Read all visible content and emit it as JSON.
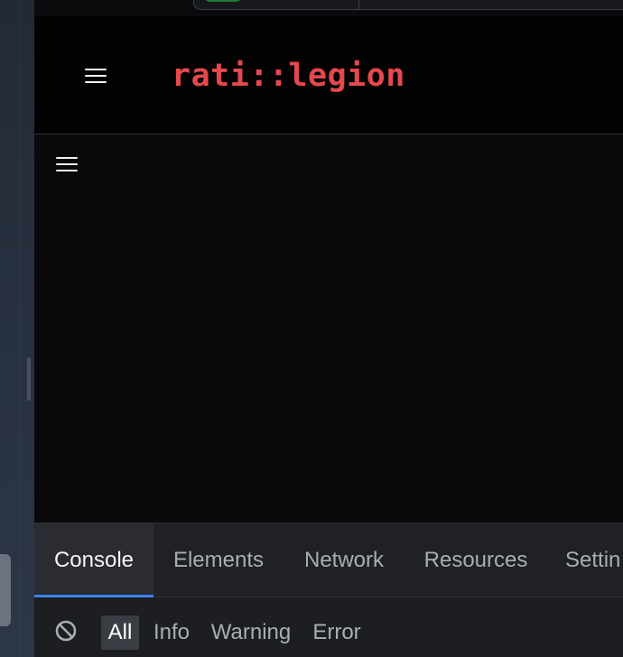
{
  "app": {
    "brand": "rati::legion",
    "brand_color": "#e5484d",
    "menu_icon": "hamburger-icon",
    "sidebar_toggle_icon": "hamburger-icon"
  },
  "devtools": {
    "tabs": [
      {
        "label": "Console",
        "active": true
      },
      {
        "label": "Elements",
        "active": false
      },
      {
        "label": "Network",
        "active": false
      },
      {
        "label": "Resources",
        "active": false
      },
      {
        "label": "Settin",
        "active": false
      }
    ],
    "clear_icon": "clear-console-icon",
    "filters": [
      {
        "label": "All",
        "active": true
      },
      {
        "label": "Info",
        "active": false
      },
      {
        "label": "Warning",
        "active": false
      },
      {
        "label": "Error",
        "active": false
      }
    ],
    "accent_color": "#3b82f6"
  }
}
